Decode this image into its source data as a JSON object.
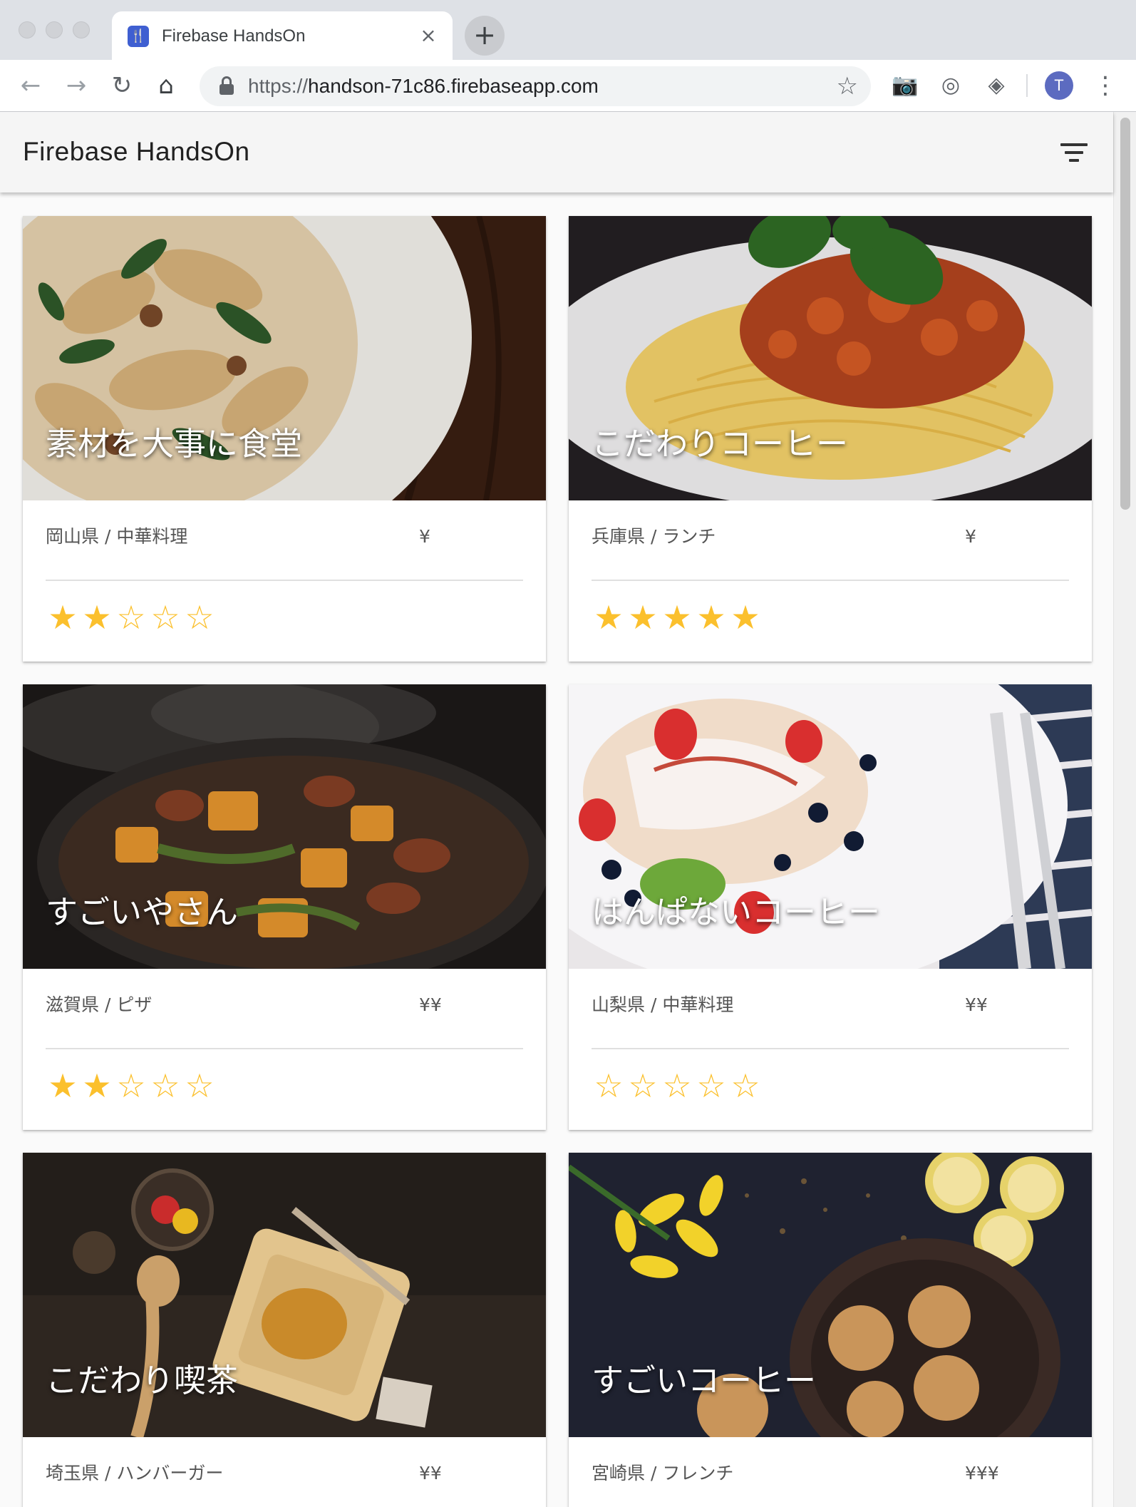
{
  "browser": {
    "tab_title": "Firebase HandsOn",
    "tab_close": "×",
    "new_tab": "+",
    "url_scheme": "https://",
    "url_host": "handson-71c86.firebaseapp.com",
    "profile_initial": "T"
  },
  "app": {
    "title": "Firebase HandsOn"
  },
  "restaurants": [
    {
      "name": "素材を大事に食堂",
      "location": "岡山県 / 中華料理",
      "price": "¥",
      "rating": 2
    },
    {
      "name": "こだわりコーヒー",
      "location": "兵庫県 / ランチ",
      "price": "¥",
      "rating": 5
    },
    {
      "name": "すごいやさん",
      "location": "滋賀県 / ピザ",
      "price": "¥¥",
      "rating": 2
    },
    {
      "name": "はんぱないコーヒー",
      "location": "山梨県 / 中華料理",
      "price": "¥¥",
      "rating": 0
    },
    {
      "name": "こだわり喫茶",
      "location": "埼玉県 / ハンバーガー",
      "price": "¥¥",
      "rating": null
    },
    {
      "name": "すごいコーヒー",
      "location": "宮崎県 / フレンチ",
      "price": "¥¥¥",
      "rating": null
    }
  ],
  "colors": {
    "star": "#fbc02d",
    "app_bar": "#f5f5f5",
    "favicon": "#3f5fd1"
  }
}
